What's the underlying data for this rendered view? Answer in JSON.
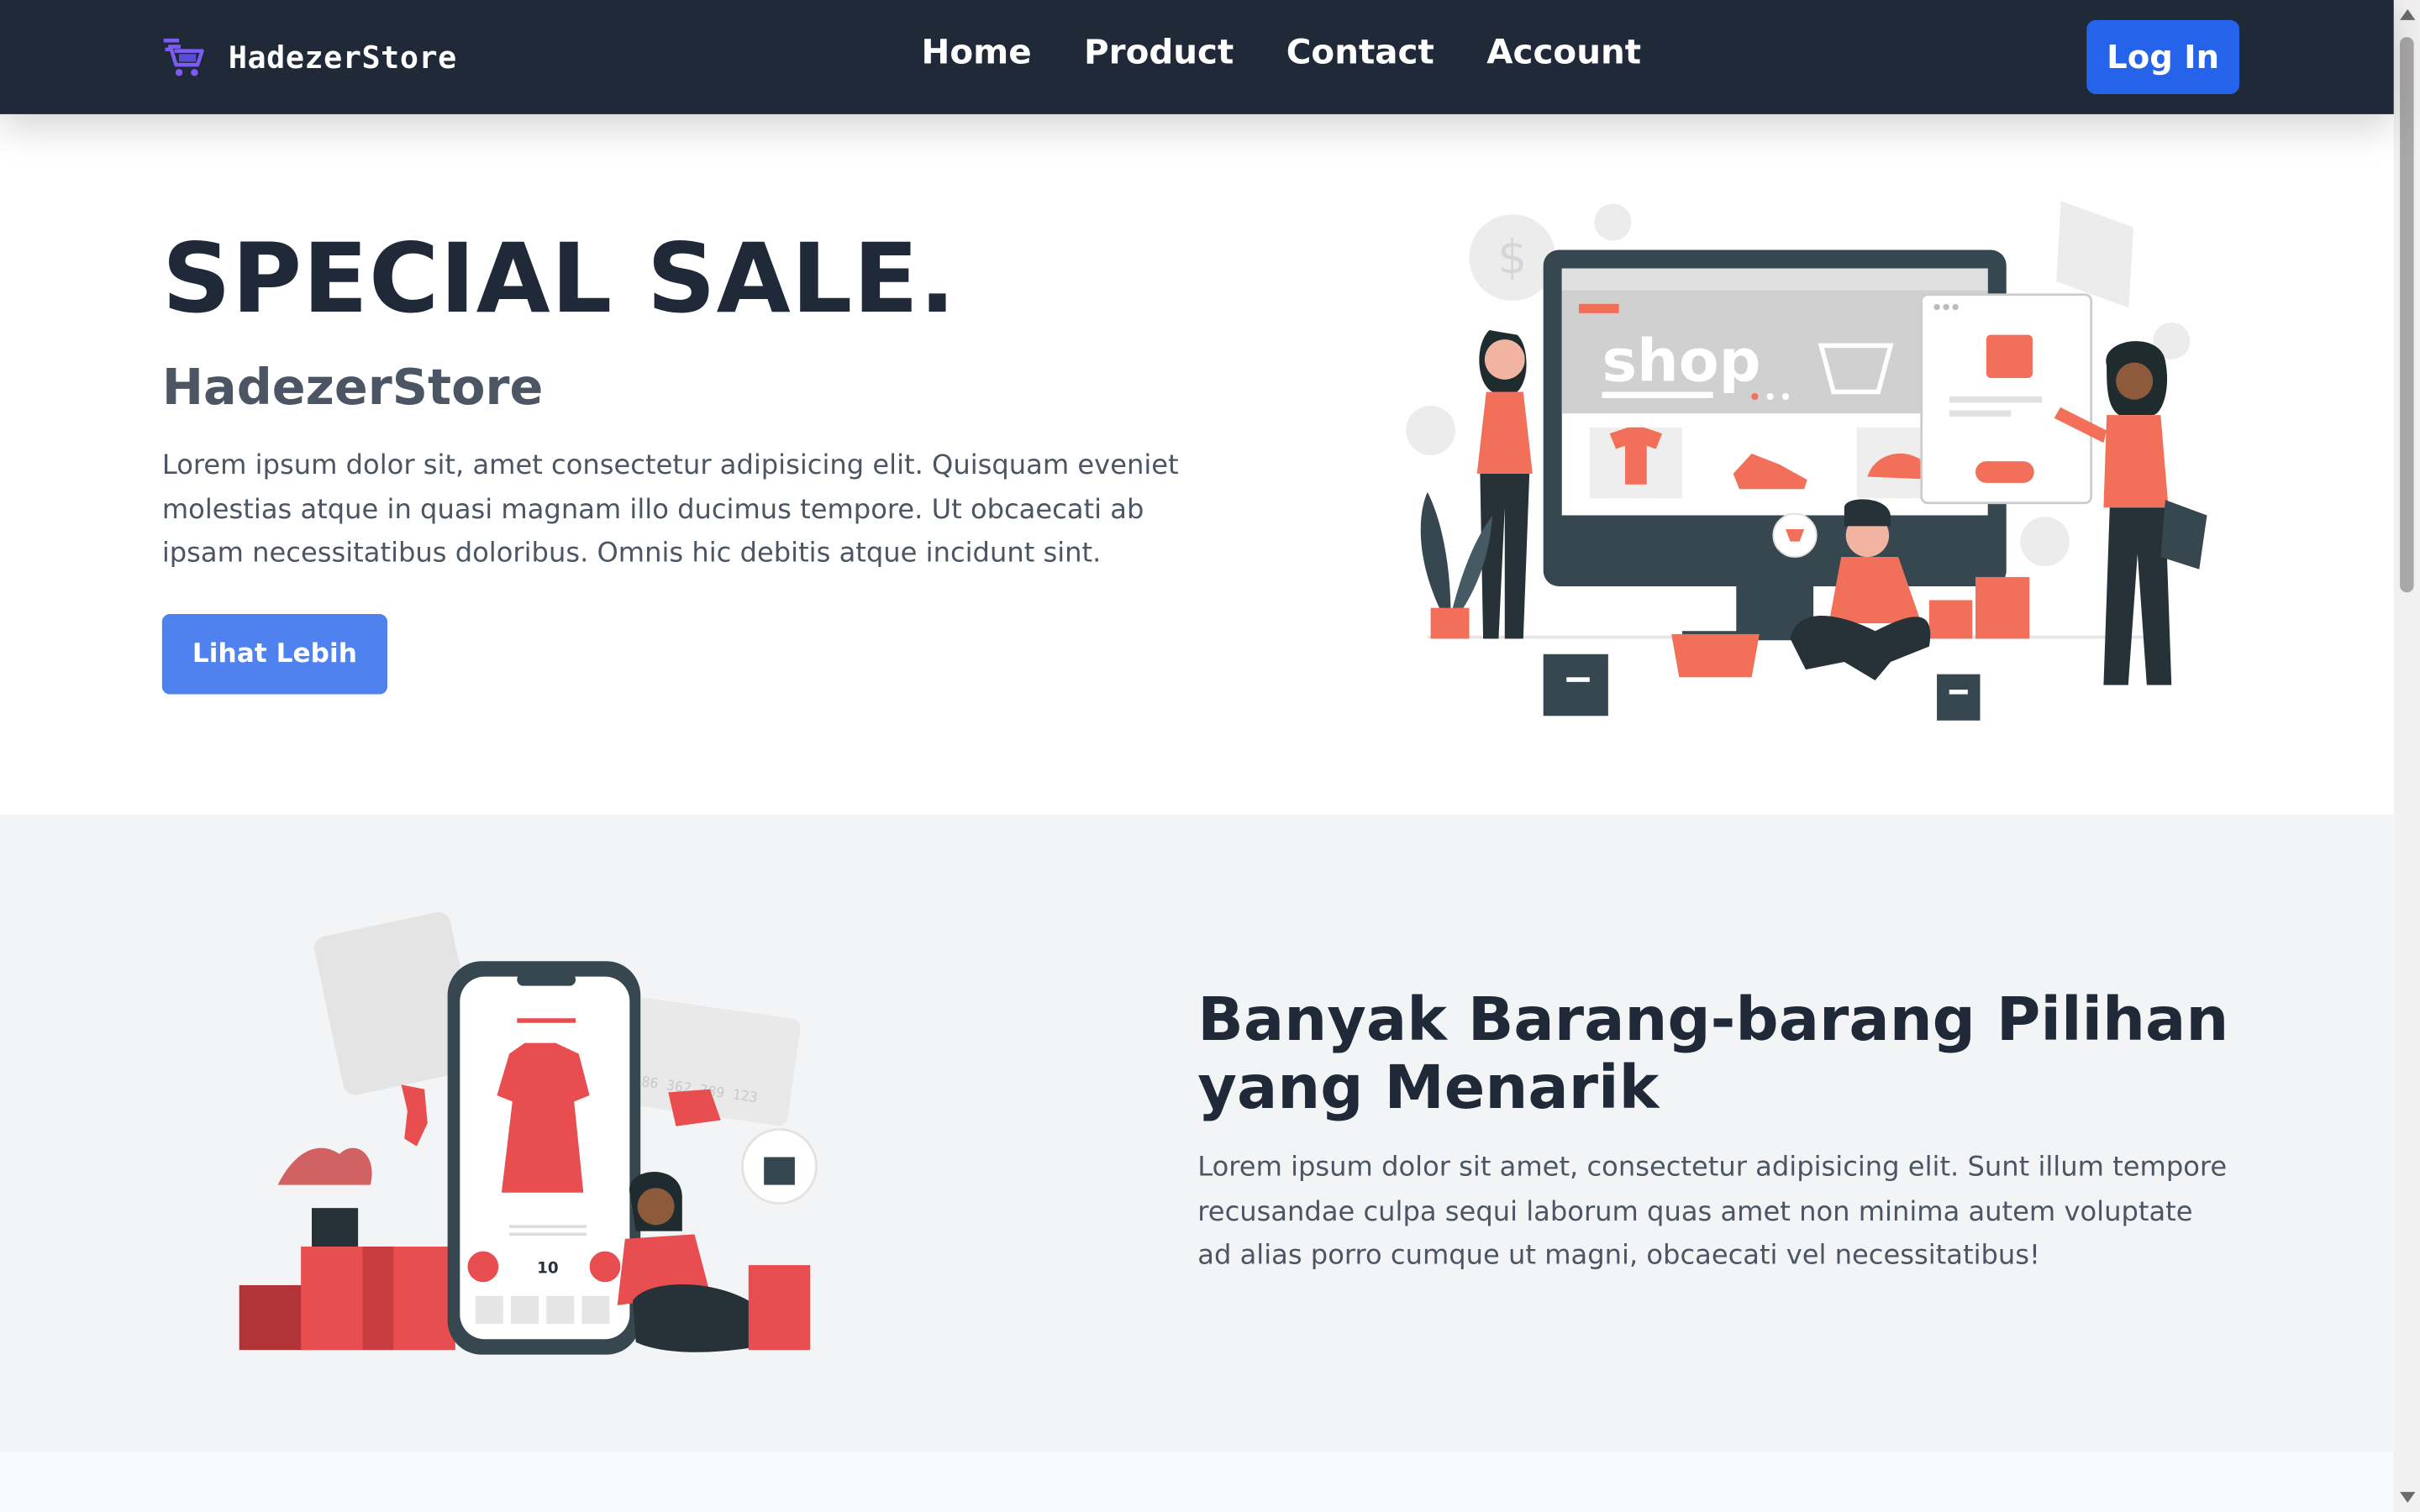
{
  "header": {
    "brand_name": "HadezerStore",
    "nav_items": [
      "Home",
      "Product",
      "Contact",
      "Account"
    ],
    "login_label": "Log In"
  },
  "hero": {
    "title": "SPECIAL SALE.",
    "subtitle": "HadezerStore",
    "text": "Lorem ipsum dolor sit, amet consectetur adipisicing elit. Quisquam eveniet molestias atque in quasi magnam illo ducimus tempore. Ut obcaecati ab ipsam necessitatibus doloribus. Omnis hic debitis atque incidunt sint.",
    "button_label": "Lihat Lebih",
    "illustration_text": "shop"
  },
  "features": {
    "title": "Banyak Barang-barang Pilihan yang Menarik",
    "text": "Lorem ipsum dolor sit amet, consectetur adipisicing elit. Sunt illum tempore recusandae culpa sequi laborum quas amet non minima autem voluptate ad alias porro cumque ut magni, obcaecati vel necessitatibus!",
    "phone_price": "10",
    "card_number": "86 362 789 123"
  },
  "colors": {
    "navbar": "#1f2937",
    "primary": "#2563eb",
    "button": "#4f82ef",
    "accent_coral": "#f27059",
    "accent_red": "#e84d4f",
    "section_bg": "#f3f4f6"
  },
  "icons": {
    "brand": "shopping-cart-icon"
  }
}
